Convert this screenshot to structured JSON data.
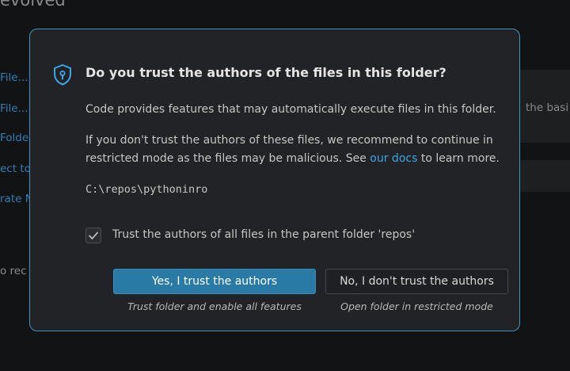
{
  "background": {
    "title": "evolved",
    "start_items": [
      "File...",
      "File...",
      "Folde",
      "ect to",
      "rate N"
    ],
    "recent_text": "o rec",
    "card_text": "the basi"
  },
  "dialog": {
    "icon": "shield-icon",
    "title": "Do you trust the authors of the files in this folder?",
    "description": "Code provides features that may automatically execute files in this folder.",
    "warning_before_link": "If you don't trust the authors of these files, we recommend to continue in restricted mode as the files may be malicious. See ",
    "warning_link": "our docs",
    "warning_after_link": " to learn more.",
    "folder_path": "C:\\repos\\pythoninro",
    "checkbox": {
      "checked": true,
      "label": "Trust the authors of all files in the parent folder 'repos'"
    },
    "buttons": {
      "trust_label": "Yes, I trust the authors",
      "trust_description": "Trust folder and enable all features",
      "distrust_label": "No, I don't trust the authors",
      "distrust_description": "Open folder in restricted mode"
    }
  },
  "colors": {
    "accent": "#3ea6e6",
    "primary_button": "#2a7aa6",
    "dialog_border": "#3f8fc0"
  }
}
